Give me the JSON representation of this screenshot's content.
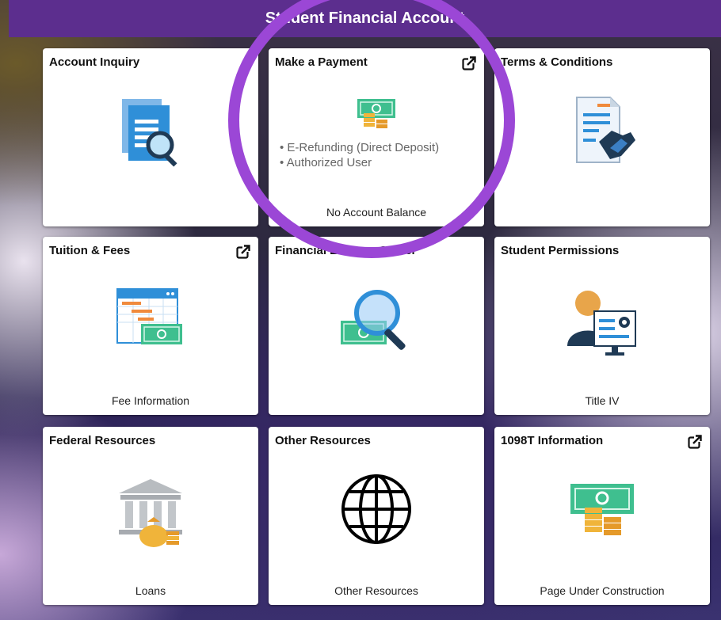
{
  "banner": {
    "title": "Student Financial Account"
  },
  "tiles": [
    {
      "title": "Account Inquiry",
      "icon": "document-search-icon",
      "footer": ""
    },
    {
      "title": "Make a Payment",
      "icon": "money-coins-icon",
      "external": true,
      "bullets": [
        "E-Refunding (Direct Deposit)",
        "Authorized User"
      ],
      "footer": "No Account Balance"
    },
    {
      "title": "Terms & Conditions",
      "icon": "contract-handshake-icon",
      "footer": ""
    },
    {
      "title": "Tuition & Fees",
      "icon": "calendar-money-icon",
      "external": true,
      "footer": "Fee Information"
    },
    {
      "title": "Financial Literacy Center",
      "icon": "money-magnifier-icon",
      "footer": ""
    },
    {
      "title": "Student Permissions",
      "icon": "user-settings-icon",
      "footer": "Title IV"
    },
    {
      "title": "Federal Resources",
      "icon": "bank-moneybag-icon",
      "footer": "Loans"
    },
    {
      "title": "Other Resources",
      "icon": "globe-icon",
      "footer": "Other Resources"
    },
    {
      "title": "1098T Information",
      "icon": "money-coins-icon",
      "external": true,
      "footer": "Page Under Construction"
    }
  ],
  "colors": {
    "banner": "#5c2e8e",
    "highlight_circle": "#9b47d6",
    "money_green": "#3fbf8f",
    "coin_gold": "#f0b43a",
    "doc_blue": "#2f8fd8"
  }
}
